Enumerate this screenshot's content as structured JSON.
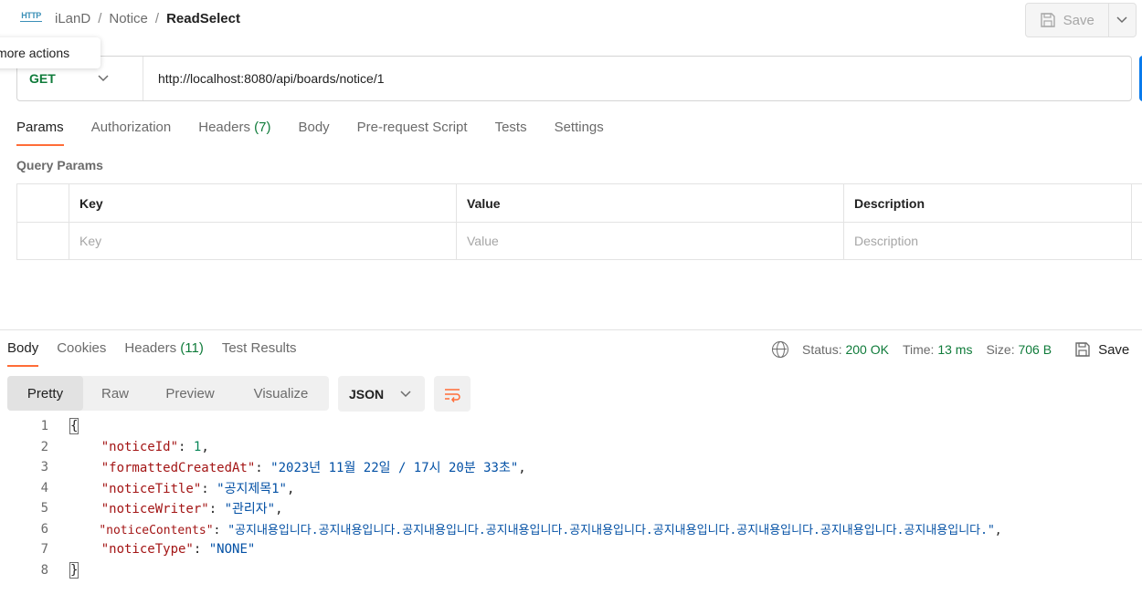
{
  "header": {
    "breadcrumb": [
      "iLanD",
      "Notice",
      "ReadSelect"
    ],
    "save_label": "Save",
    "tooltip": "View more actions",
    "method_icon_label": "HTTP"
  },
  "request": {
    "method": "GET",
    "url": "http://localhost:8080/api/boards/notice/1",
    "tabs": [
      {
        "label": "Params",
        "count": ""
      },
      {
        "label": "Authorization",
        "count": ""
      },
      {
        "label": "Headers",
        "count": "(7)"
      },
      {
        "label": "Body",
        "count": ""
      },
      {
        "label": "Pre-request Script",
        "count": ""
      },
      {
        "label": "Tests",
        "count": ""
      },
      {
        "label": "Settings",
        "count": ""
      }
    ],
    "query_params_title": "Query Params",
    "columns": [
      "Key",
      "Value",
      "Description"
    ],
    "placeholders": [
      "Key",
      "Value",
      "Description"
    ]
  },
  "response": {
    "tabs": [
      {
        "label": "Body",
        "count": ""
      },
      {
        "label": "Cookies",
        "count": ""
      },
      {
        "label": "Headers",
        "count": "(11)"
      },
      {
        "label": "Test Results",
        "count": ""
      }
    ],
    "status_label": "Status:",
    "status_value": "200 OK",
    "time_label": "Time:",
    "time_value": "13 ms",
    "size_label": "Size:",
    "size_value": "706 B",
    "save_label": "Save",
    "views": [
      "Pretty",
      "Raw",
      "Preview",
      "Visualize"
    ],
    "format": "JSON",
    "line_numbers": [
      "1",
      "2",
      "3",
      "4",
      "5",
      "6",
      "7",
      "8"
    ],
    "fields": {
      "noticeId_key": "\"noticeId\"",
      "noticeId_val": "1",
      "createdAt_key": "\"formattedCreatedAt\"",
      "createdAt_val": "\"2023년 11월 22일 / 17시 20분 33초\"",
      "title_key": "\"noticeTitle\"",
      "title_val": "\"공지제목1\"",
      "writer_key": "\"noticeWriter\"",
      "writer_val": "\"관리자\"",
      "contents_key": "\"noticeContents\"",
      "contents_val": "\"공지내용입니다.공지내용입니다.공지내용입니다.공지내용입니다.공지내용입니다.공지내용입니다.공지내용입니다.공지내용입니다.공지내용입니다.\"",
      "type_key": "\"noticeType\"",
      "type_val": "\"NONE\""
    }
  },
  "colors": {
    "accent": "#ff6c37",
    "method_green": "#0f7b3a",
    "send_blue": "#097bed"
  }
}
